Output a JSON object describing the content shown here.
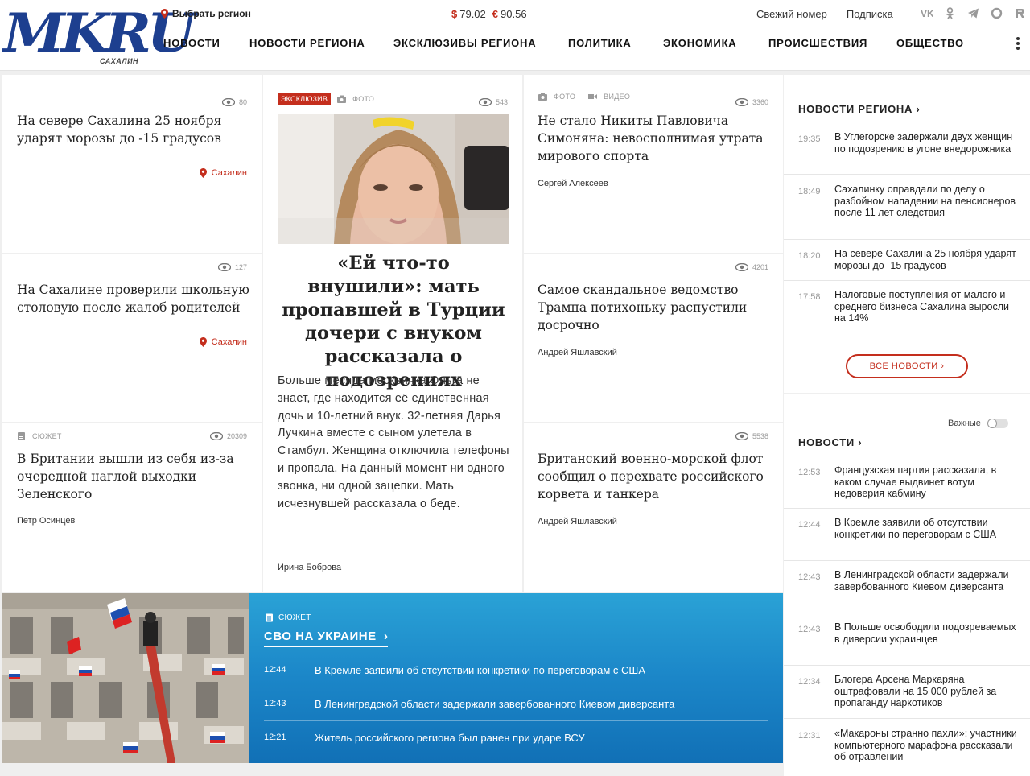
{
  "header": {
    "logo": "MKRU",
    "logo_sub": "САХАЛИН",
    "region_label": "Выбрать регион",
    "currency": [
      {
        "symbol": "$",
        "value": "79.02"
      },
      {
        "symbol": "€",
        "value": "90.56"
      }
    ],
    "links": [
      "Свежий номер",
      "Подписка"
    ],
    "socials": [
      "vk-icon",
      "odnoklassniki-icon",
      "telegram-icon",
      "max-icon",
      "rutube-icon"
    ],
    "nav": [
      "НОВОСТИ",
      "НОВОСТИ РЕГИОНА",
      "ЭКСКЛЮЗИВЫ РЕГИОНА",
      "ПОЛИТИКА",
      "ЭКОНОМИКА",
      "ПРОИСШЕСТВИЯ",
      "ОБЩЕСТВО"
    ]
  },
  "cards": {
    "c1": {
      "views": "80",
      "title": "На севере Сахалина 25 ноября ударят морозы до -15 градусов",
      "location": "Сахалин"
    },
    "c2": {
      "views": "127",
      "title": "На Сахалине проверили школьную столовую после жалоб родителей",
      "location": "Сахалин"
    },
    "c3": {
      "tag": "СЮЖЕТ",
      "views": "20309",
      "title": "В Британии вышли из себя из-за очередной наглой выходки Зеленского",
      "author": "Петр Осинцев"
    },
    "feature": {
      "tag_exclusive": "ЭКСКЛЮЗИВ",
      "tag_photo": "ФОТО",
      "views": "543",
      "title": "«Ей что-то внушили»: мать пропавшей в Турции дочери с внуком рассказала о подозрениях",
      "text": "Больше месяца москвичка Ольга не знает, где находится её единственная дочь и 10-летний внук. 32-летняя Дарья Лучкина вместе с сыном улетела в Стамбул. Женщина отключила телефоны и пропала. На данный момент ни одного звонка, ни одной зацепки. Мать исчезнувшей рассказала о беде.",
      "author": "Ирина Боброва"
    },
    "c4": {
      "tag_photo": "ФОТО",
      "tag_video": "ВИДЕО",
      "views": "3360",
      "title": "Не стало Никиты Павловича Симоняна: невосполнимая утрата мирового спорта",
      "author": "Сергей Алексеев"
    },
    "c5": {
      "views": "4201",
      "title": "Самое скандальное ведомство Трампа потихоньку распустили досрочно",
      "author": "Андрей Яшлавский"
    },
    "c6": {
      "views": "5538",
      "title": "Британский военно-морской флот сообщил о перехвате российского корвета и танкера",
      "author": "Андрей Яшлавский"
    }
  },
  "region_news": {
    "title": "НОВОСТИ РЕГИОНА",
    "items": [
      {
        "time": "19:35",
        "text": "В Углегорске задержали двух женщин по подозрению в угоне внедорожника"
      },
      {
        "time": "18:49",
        "text": "Сахалинку оправдали по делу о разбойном нападении на пенсионеров после 11 лет следствия"
      },
      {
        "time": "18:20",
        "text": "На севере Сахалина 25 ноября ударят морозы до -15 градусов"
      },
      {
        "time": "17:58",
        "text": "Налоговые поступления от малого и среднего бизнеса Сахалина выросли на 14%"
      }
    ],
    "all_button": "ВСЕ НОВОСТИ"
  },
  "news": {
    "title": "НОВОСТИ",
    "toggle_label": "Важные",
    "items": [
      {
        "time": "12:53",
        "text": "Французская партия рассказала, в каком случае выдвинет вотум недоверия кабмину"
      },
      {
        "time": "12:44",
        "text": "В Кремле заявили об отсутствии конкретики по переговорам с США"
      },
      {
        "time": "12:43",
        "text": "В Ленинградской области задержали завербованного Киевом диверсанта"
      },
      {
        "time": "12:43",
        "text": "В Польше освободили подозреваемых в диверсии украинцев"
      },
      {
        "time": "12:34",
        "text": "Блогера Арсена Маркаряна оштрафовали на 15 000 рублей за пропаганду наркотиков"
      },
      {
        "time": "12:31",
        "text": "«Макароны странно пахли»: участники компьютерного марафона рассказали об отравлении"
      }
    ]
  },
  "banner": {
    "tag": "СЮЖЕТ",
    "title": "СВО НА УКРАИНЕ",
    "items": [
      {
        "time": "12:44",
        "text": "В Кремле заявили об отсутствии конкретики по переговорам с США"
      },
      {
        "time": "12:43",
        "text": "В Ленинградской области задержали завербованного Киевом диверсанта"
      },
      {
        "time": "12:21",
        "text": "Житель российского региона был ранен при ударе ВСУ"
      }
    ]
  },
  "colors": {
    "accent": "#c42e1d",
    "logo": "#1d3f8f",
    "banner": "#1b86c8"
  }
}
